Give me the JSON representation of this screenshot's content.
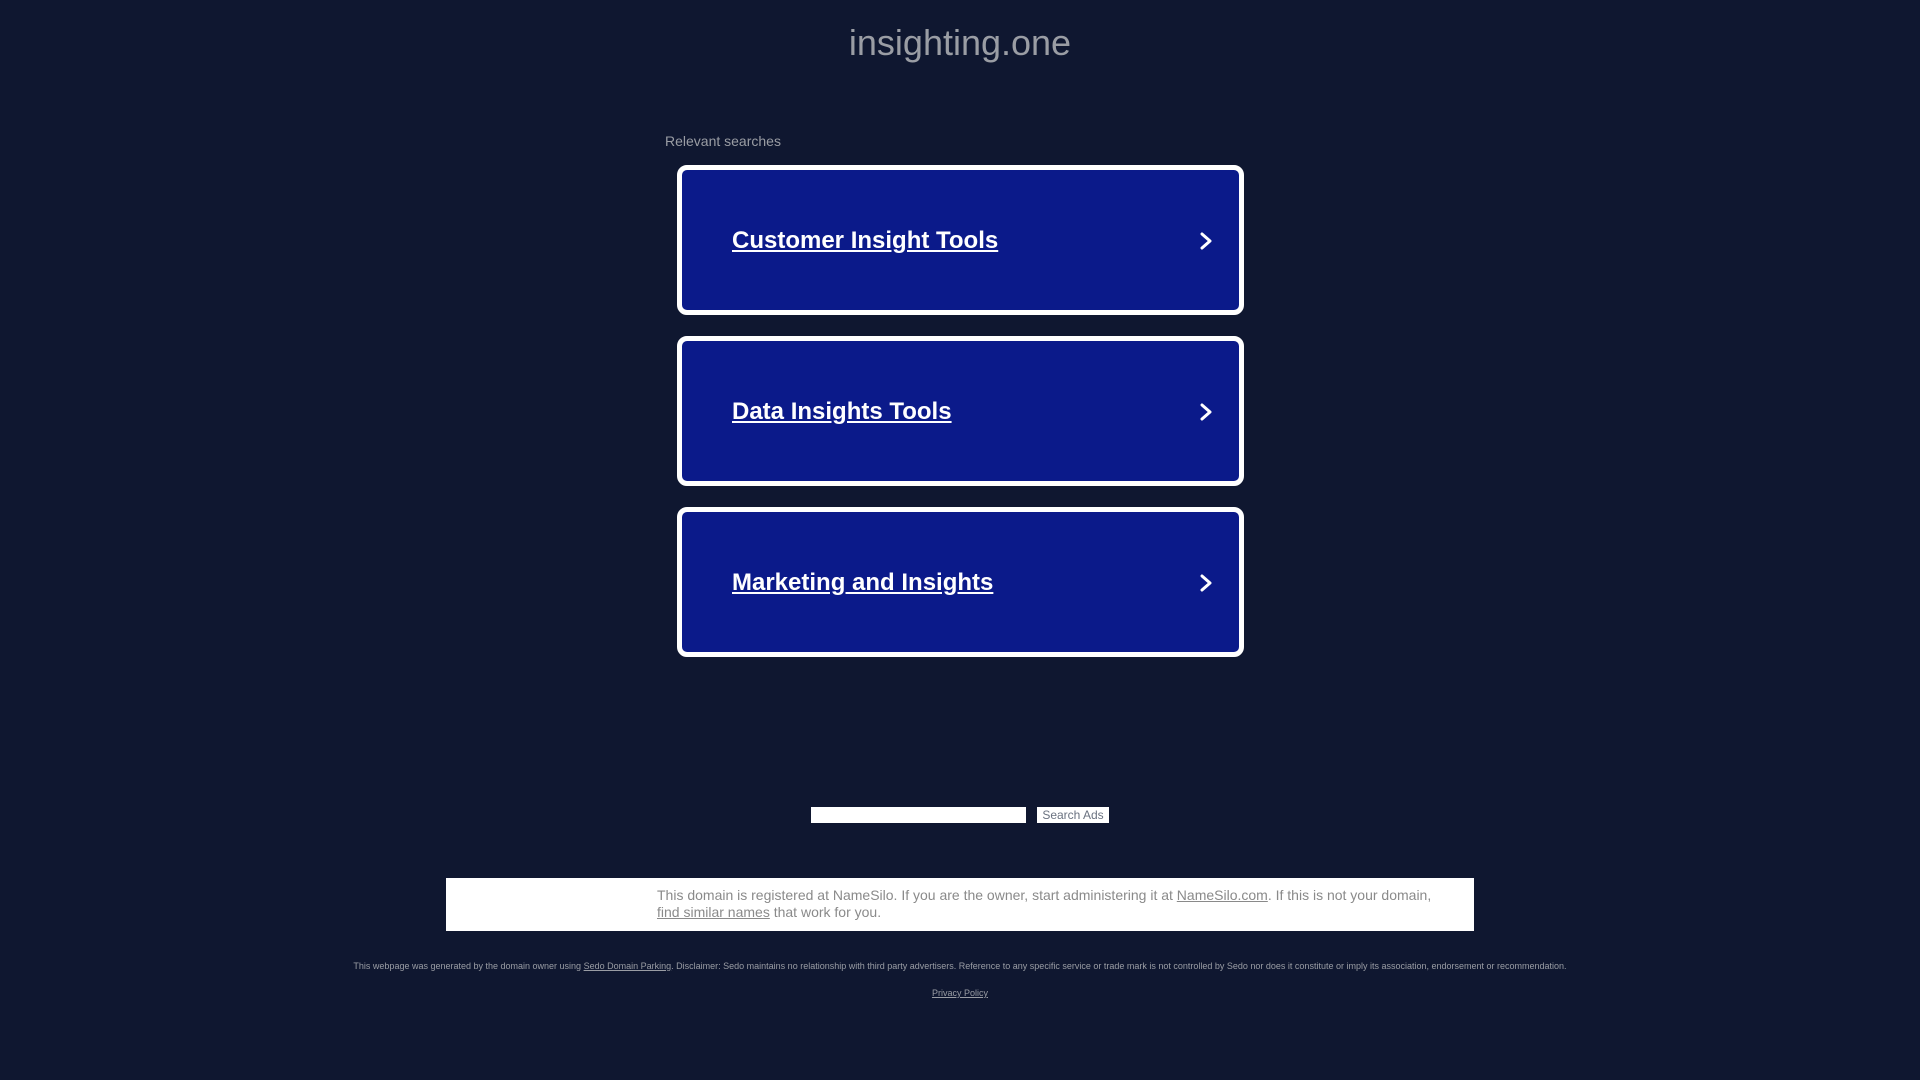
{
  "header": {
    "domain": "insighting.one"
  },
  "searches": {
    "label": "Relevant searches",
    "items": [
      {
        "label": "Customer Insight Tools"
      },
      {
        "label": "Data Insights Tools"
      },
      {
        "label": "Marketing and Insights"
      }
    ]
  },
  "search": {
    "input_value": "",
    "button_label": "Search Ads"
  },
  "notice": {
    "text_before": "This domain is registered at NameSilo. If you are the owner, start administering it at ",
    "link_namesilo": "NameSilo.com",
    "text_middle": ". If this is not your domain, ",
    "link_similar": "find similar names",
    "text_after": " that work for you."
  },
  "footer": {
    "disclaimer_before": "This webpage was generated by the domain owner using ",
    "disclaimer_link": "Sedo Domain Parking",
    "disclaimer_after": ". Disclaimer: Sedo maintains no relationship with third party advertisers. Reference to any specific service or trade mark is not controlled by Sedo nor does it constitute or imply its association, endorsement or recommendation.",
    "privacy_label": "Privacy Policy"
  },
  "colors": {
    "background": "#0f1730",
    "ad_block": "#0b1a8a",
    "ad_border": "#ffffff",
    "muted_text": "#9a9da4"
  },
  "icons": {
    "ad_arrow": "chevron-right-icon"
  }
}
